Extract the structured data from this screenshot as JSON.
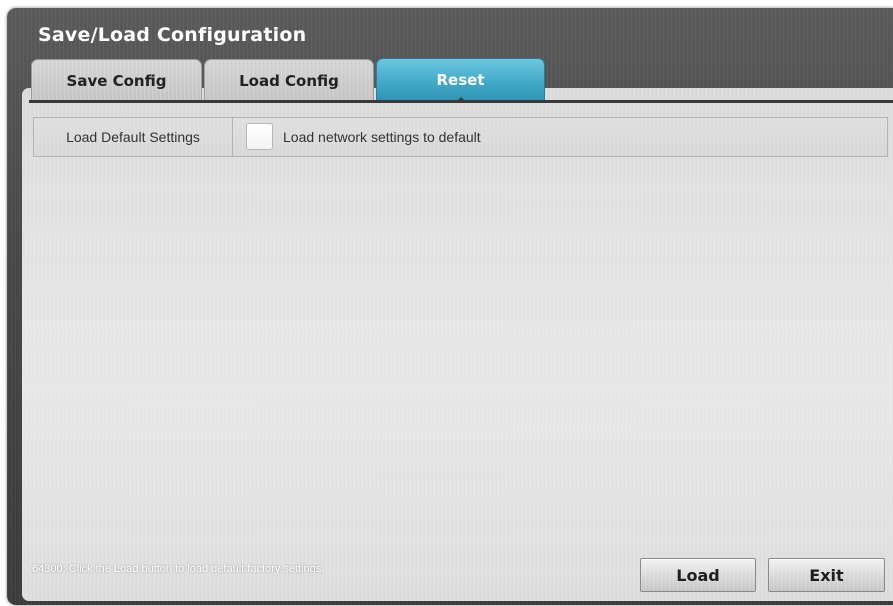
{
  "window": {
    "title": "Save/Load Configuration"
  },
  "tabs": [
    {
      "label": "Save Config",
      "active": false
    },
    {
      "label": "Load Config",
      "active": false
    },
    {
      "label": "Reset",
      "active": true
    }
  ],
  "settings": {
    "row_label": "Load Default Settings",
    "checkbox_label": "Load network settings to default",
    "checkbox_checked": false
  },
  "status": {
    "message": "64300: Click the Load button to load default factory settings."
  },
  "buttons": {
    "load_label": "Load",
    "exit_label": "Exit"
  },
  "colors": {
    "active_tab": "#41a9c7",
    "frame": "#484848",
    "panel": "#e2e2e2"
  }
}
